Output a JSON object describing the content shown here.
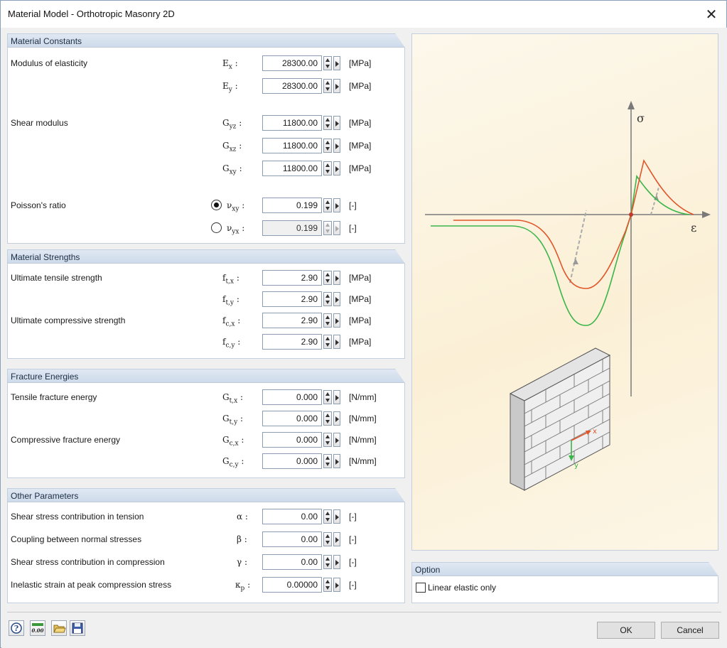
{
  "window": {
    "title": "Material Model - Orthotropic Masonry 2D",
    "close_icon": "close-icon"
  },
  "material_constants": {
    "title": "Material Constants",
    "elasticity_label": "Modulus of elasticity",
    "shear_label": "Shear modulus",
    "poisson_label": "Poisson's ratio",
    "ex": {
      "sym": "E",
      "sub": "x",
      "value": "28300.00",
      "unit": "[MPa]"
    },
    "ey": {
      "sym": "E",
      "sub": "y",
      "value": "28300.00",
      "unit": "[MPa]"
    },
    "gyz": {
      "sym": "G",
      "sub": "yz",
      "value": "11800.00",
      "unit": "[MPa]"
    },
    "gxz": {
      "sym": "G",
      "sub": "xz",
      "value": "11800.00",
      "unit": "[MPa]"
    },
    "gxy": {
      "sym": "G",
      "sub": "xy",
      "value": "11800.00",
      "unit": "[MPa]"
    },
    "vxy": {
      "sym": "ν",
      "sub": "xy",
      "value": "0.199",
      "unit": "[-]",
      "selected": true
    },
    "vyx": {
      "sym": "ν",
      "sub": "yx",
      "value": "0.199",
      "unit": "[-]",
      "selected": false
    }
  },
  "material_strengths": {
    "title": "Material Strengths",
    "tensile_label": "Ultimate tensile strength",
    "compressive_label": "Ultimate compressive strength",
    "ftx": {
      "sym": "f",
      "sub": "t,x",
      "value": "2.90",
      "unit": "[MPa]"
    },
    "fty": {
      "sym": "f",
      "sub": "t,y",
      "value": "2.90",
      "unit": "[MPa]"
    },
    "fcx": {
      "sym": "f",
      "sub": "c,x",
      "value": "2.90",
      "unit": "[MPa]"
    },
    "fcy": {
      "sym": "f",
      "sub": "c,y",
      "value": "2.90",
      "unit": "[MPa]"
    }
  },
  "fracture_energies": {
    "title": "Fracture Energies",
    "tensile_label": "Tensile fracture energy",
    "compressive_label": "Compressive fracture energy",
    "gtx": {
      "sym": "G",
      "sub": "t,x",
      "value": "0.000",
      "unit": "[N/mm]"
    },
    "gty": {
      "sym": "G",
      "sub": "t,y",
      "value": "0.000",
      "unit": "[N/mm]"
    },
    "gcx": {
      "sym": "G",
      "sub": "c,x",
      "value": "0.000",
      "unit": "[N/mm]"
    },
    "gcy": {
      "sym": "G",
      "sub": "c,y",
      "value": "0.000",
      "unit": "[N/mm]"
    }
  },
  "other_parameters": {
    "title": "Other Parameters",
    "alpha": {
      "label": "Shear stress contribution in tension",
      "sym": "α",
      "sub": "",
      "value": "0.00",
      "unit": "[-]"
    },
    "beta": {
      "label": "Coupling between normal stresses",
      "sym": "β",
      "sub": "",
      "value": "0.00",
      "unit": "[-]"
    },
    "gamma": {
      "label": "Shear stress contribution in compression",
      "sym": "γ",
      "sub": "",
      "value": "0.00",
      "unit": "[-]"
    },
    "kappa": {
      "label": "Inelastic strain at peak compression stress",
      "sym": "κ",
      "sub": "p",
      "value": "0.00000",
      "unit": "[-]"
    }
  },
  "diagram": {
    "sigma_label": "σ",
    "epsilon_label": "ε",
    "x_label": "x",
    "y_label": "y"
  },
  "option": {
    "title": "Option",
    "linear_elastic_label": "Linear elastic only",
    "linear_elastic_checked": false
  },
  "footer": {
    "icons": [
      "help-icon",
      "units-icon",
      "open-icon",
      "save-icon"
    ],
    "units_icon_text": "0.00",
    "ok_label": "OK",
    "cancel_label": "Cancel"
  },
  "colors": {
    "orange_curve": "#e0552a",
    "green_curve": "#3bb54a",
    "group_header": "#d6e1ee"
  }
}
